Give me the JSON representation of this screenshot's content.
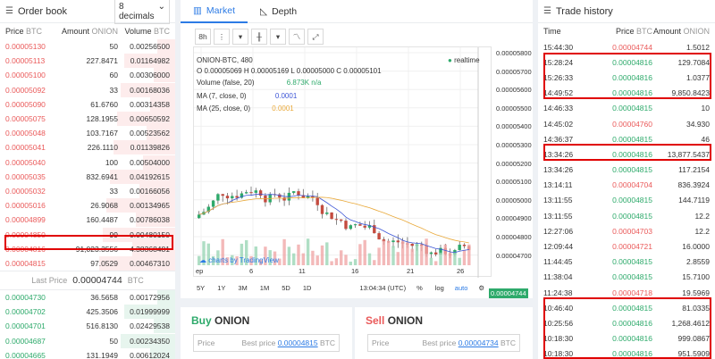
{
  "order_book": {
    "title": "Order book",
    "decimals": "8 decimals",
    "cols": {
      "price": "Price",
      "price_unit": "BTC",
      "amount": "Amount",
      "amount_unit": "ONION",
      "volume": "Volume",
      "volume_unit": "BTC"
    },
    "asks": [
      {
        "price": "0.00005130",
        "amount": "50",
        "volume": "0.00256500"
      },
      {
        "price": "0.00005113",
        "amount": "227.8471",
        "volume": "0.01164982"
      },
      {
        "price": "0.00005100",
        "amount": "60",
        "volume": "0.00306000"
      },
      {
        "price": "0.00005092",
        "amount": "33",
        "volume": "0.00168036"
      },
      {
        "price": "0.00005090",
        "amount": "61.6760",
        "volume": "0.00314358"
      },
      {
        "price": "0.00005075",
        "amount": "128.1955",
        "volume": "0.00650592"
      },
      {
        "price": "0.00005048",
        "amount": "103.7167",
        "volume": "0.00523562"
      },
      {
        "price": "0.00005041",
        "amount": "226.1110",
        "volume": "0.01139826"
      },
      {
        "price": "0.00005040",
        "amount": "100",
        "volume": "0.00504000"
      },
      {
        "price": "0.00005035",
        "amount": "832.6941",
        "volume": "0.04192615"
      },
      {
        "price": "0.00005032",
        "amount": "33",
        "volume": "0.00166056"
      },
      {
        "price": "0.00005016",
        "amount": "26.9068",
        "volume": "0.00134965"
      },
      {
        "price": "0.00004899",
        "amount": "160.4487",
        "volume": "0.00786038"
      },
      {
        "price": "0.00004850",
        "amount": "99",
        "volume": "0.00480150"
      },
      {
        "price": "0.00004816",
        "amount": "91,023.3556",
        "volume": "4.38368481"
      },
      {
        "price": "0.00004815",
        "amount": "97.0529",
        "volume": "0.00467310"
      }
    ],
    "last_price_label": "Last Price",
    "last_price": "0.00004744",
    "last_price_unit": "BTC",
    "bids": [
      {
        "price": "0.00004730",
        "amount": "36.5658",
        "volume": "0.00172956"
      },
      {
        "price": "0.00004702",
        "amount": "425.3506",
        "volume": "0.01999999"
      },
      {
        "price": "0.00004701",
        "amount": "516.8130",
        "volume": "0.02429538"
      },
      {
        "price": "0.00004687",
        "amount": "50",
        "volume": "0.00234350"
      },
      {
        "price": "0.00004665",
        "amount": "131.1949",
        "volume": "0.00612024"
      }
    ]
  },
  "market": {
    "tabs": [
      "Market",
      "Depth"
    ],
    "interval": "8h",
    "pair_line": "ONION-BTC, 480",
    "ohlc": "O 0.00005069 H 0.00005169 L 0.00005000 C 0.00005101",
    "volume_line": "Volume (false, 20)",
    "volume_value": "6.873K n/a",
    "ma7_line": "MA (7, close, 0)",
    "ma7_value": "0.0001",
    "ma25_line": "MA (25, close, 0)",
    "ma25_value": "0.0001",
    "realtime": "realtime",
    "price_label": "0.00004744",
    "watermark": "charts by TradingView",
    "yticks": [
      "0.00005800",
      "0.00005700",
      "0.00005600",
      "0.00005500",
      "0.00005400",
      "0.00005300",
      "0.00005200",
      "0.00005100",
      "0.00005000",
      "0.00004900",
      "0.00004800",
      "0.00004700"
    ],
    "xticks": [
      "ep",
      "6",
      "11",
      "16",
      "21",
      "26"
    ],
    "ranges": [
      "5Y",
      "1Y",
      "3M",
      "1M",
      "5D",
      "1D"
    ],
    "time": "13:04:34 (UTC)",
    "pct": "%",
    "log": "log",
    "auto": "auto",
    "colors": {
      "up": "#2eaa6b",
      "down": "#c44b3f",
      "ma7": "#3d56d6",
      "ma25": "#e9a93a"
    }
  },
  "buy": {
    "title": "Buy",
    "coin": "ONION",
    "placeholder": "Price",
    "best_label": "Best price",
    "best_value": "0.00004815",
    "unit": "BTC"
  },
  "sell": {
    "title": "Sell",
    "coin": "ONION",
    "placeholder": "Price",
    "best_label": "Best price",
    "best_value": "0.00004734",
    "unit": "BTC"
  },
  "trade_history": {
    "title": "Trade history",
    "cols": {
      "time": "Time",
      "price": "Price",
      "price_unit": "BTC",
      "amount": "Amount",
      "amount_unit": "ONION"
    },
    "rows": [
      {
        "time": "15:44:30",
        "price": "0.00004744",
        "amount": "1.5012",
        "side": "sell"
      },
      {
        "time": "15:28:24",
        "price": "0.00004816",
        "amount": "129.7084",
        "side": "buy"
      },
      {
        "time": "15:26:33",
        "price": "0.00004816",
        "amount": "1.0377",
        "side": "buy"
      },
      {
        "time": "14:49:52",
        "price": "0.00004816",
        "amount": "9,850.8423",
        "side": "buy"
      },
      {
        "time": "14:46:33",
        "price": "0.00004815",
        "amount": "10",
        "side": "buy"
      },
      {
        "time": "14:45:02",
        "price": "0.00004760",
        "amount": "34.930",
        "side": "sell"
      },
      {
        "time": "14:36:37",
        "price": "0.00004815",
        "amount": "46",
        "side": "buy"
      },
      {
        "time": "13:34:26",
        "price": "0.00004816",
        "amount": "13,877.5437",
        "side": "buy"
      },
      {
        "time": "13:34:26",
        "price": "0.00004815",
        "amount": "117.2154",
        "side": "buy"
      },
      {
        "time": "13:14:11",
        "price": "0.00004704",
        "amount": "836.3924",
        "side": "sell"
      },
      {
        "time": "13:11:55",
        "price": "0.00004815",
        "amount": "144.7119",
        "side": "buy"
      },
      {
        "time": "13:11:55",
        "price": "0.00004815",
        "amount": "12.2",
        "side": "buy"
      },
      {
        "time": "12:27:06",
        "price": "0.00004703",
        "amount": "12.2",
        "side": "sell"
      },
      {
        "time": "12:09:44",
        "price": "0.00004721",
        "amount": "16.0000",
        "side": "sell"
      },
      {
        "time": "11:44:45",
        "price": "0.00004815",
        "amount": "2.8559",
        "side": "buy"
      },
      {
        "time": "11:38:04",
        "price": "0.00004815",
        "amount": "15.7100",
        "side": "buy"
      },
      {
        "time": "11:24:38",
        "price": "0.00004718",
        "amount": "19.5969",
        "side": "sell"
      },
      {
        "time": "10:46:40",
        "price": "0.00004815",
        "amount": "81.0335",
        "side": "buy"
      },
      {
        "time": "10:25:56",
        "price": "0.00004816",
        "amount": "1,268.4612",
        "side": "buy"
      },
      {
        "time": "10:18:30",
        "price": "0.00004816",
        "amount": "999.0867",
        "side": "buy"
      },
      {
        "time": "10:18:30",
        "price": "0.00004816",
        "amount": "951.5909",
        "side": "buy"
      }
    ]
  }
}
